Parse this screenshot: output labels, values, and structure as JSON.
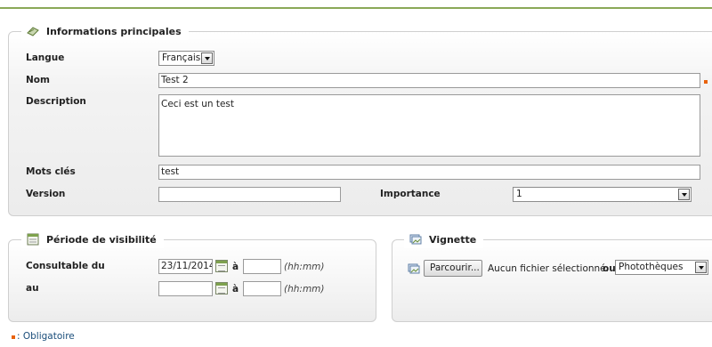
{
  "main_info": {
    "legend": "Informations principales",
    "langue_label": "Langue",
    "langue_value": "Français",
    "nom_label": "Nom",
    "nom_value": "Test 2",
    "description_label": "Description",
    "description_value": "Ceci est un test",
    "motscles_label": "Mots clés",
    "motscles_value": "test",
    "version_label": "Version",
    "version_value": "",
    "importance_label": "Importance",
    "importance_value": "1"
  },
  "visibility": {
    "legend": "Période de visibilité",
    "from_label": "Consultable du",
    "from_date": "23/11/2014",
    "a_label": "à",
    "from_time": "",
    "hint": "(hh:mm)",
    "to_label": "au",
    "to_date": "",
    "to_time": ""
  },
  "vignette": {
    "legend": "Vignette",
    "browse_label": "Parcourir...",
    "no_file": "Aucun fichier sélectionné.",
    "ou": "ou",
    "source_value": "Photothèques"
  },
  "footer": {
    "required_note": ": Obligatoire"
  },
  "colors": {
    "accent": "#8aa857",
    "required": "#e8620b"
  }
}
